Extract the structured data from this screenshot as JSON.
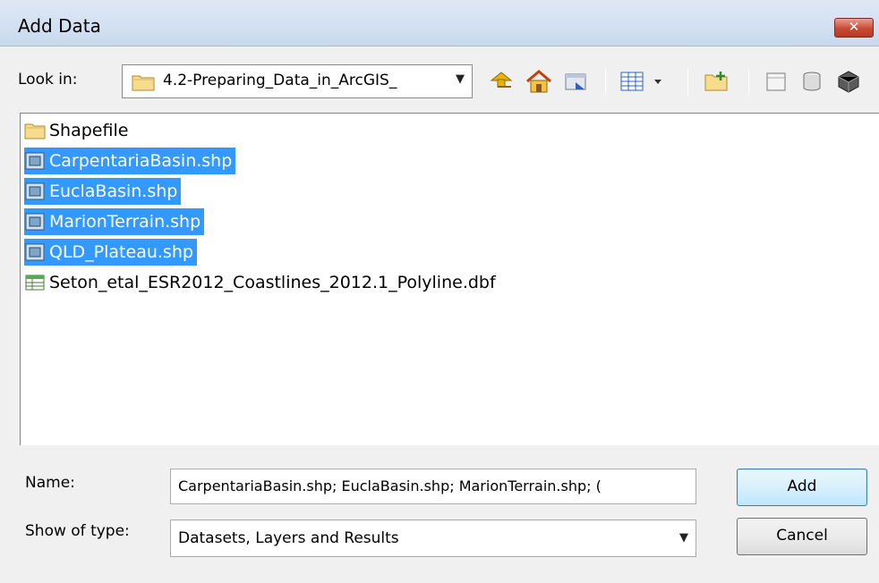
{
  "dialog": {
    "title": "Add Data",
    "close_label": "✕",
    "look_in_label": "Look in:",
    "look_in_value": "4.2-Preparing_Data_in_ArcGIS_",
    "toolbar_icons": [
      "up-one-level-icon",
      "home-icon",
      "connect-folder-icon",
      "view-options-icon",
      "new-folder-icon",
      "new-geodatabase-icon",
      "new-shapefile-icon",
      "new-feature-class-icon"
    ],
    "items": [
      {
        "label": "Shapefile",
        "icon": "folder-icon",
        "selected": false
      },
      {
        "label": "CarpentariaBasin.shp",
        "icon": "shapefile-icon",
        "selected": true
      },
      {
        "label": "EuclaBasin.shp",
        "icon": "shapefile-icon",
        "selected": true
      },
      {
        "label": "MarionTerrain.shp",
        "icon": "shapefile-icon",
        "selected": true
      },
      {
        "label": "QLD_Plateau.shp",
        "icon": "shapefile-icon",
        "selected": true
      },
      {
        "label": "Seton_etal_ESR2012_Coastlines_2012.1_Polyline.dbf",
        "icon": "table-icon",
        "selected": false
      }
    ],
    "name_label": "Name:",
    "name_value": "CarpentariaBasin.shp; EuclaBasin.shp; MarionTerrain.shp; (",
    "type_label": "Show of type:",
    "type_value": "Datasets, Layers and Results",
    "add_label": "Add",
    "cancel_label": "Cancel",
    "colors": {
      "selection": "#3399ff",
      "titlebar": "#c9d9ee",
      "close": "#c94a34"
    }
  }
}
